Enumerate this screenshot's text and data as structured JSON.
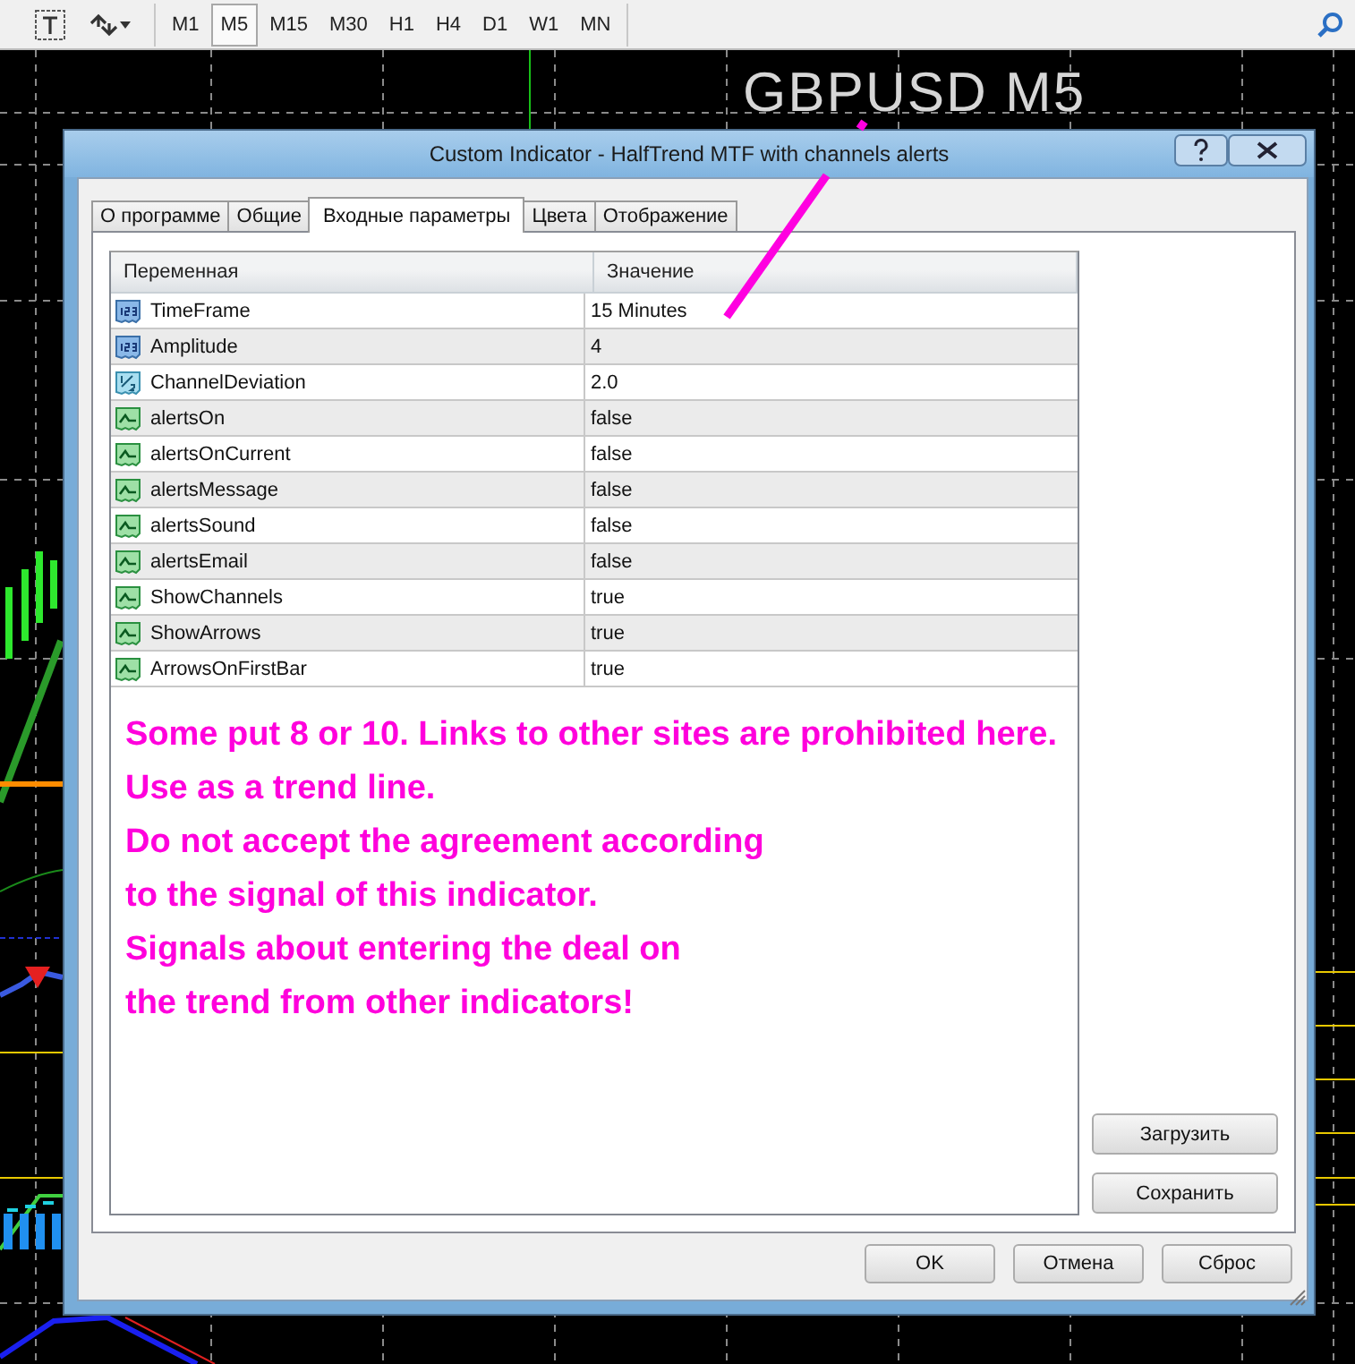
{
  "toolbar": {
    "timeframes": [
      {
        "label": "M1",
        "selected": false
      },
      {
        "label": "M5",
        "selected": true
      },
      {
        "label": "M15",
        "selected": false
      },
      {
        "label": "M30",
        "selected": false
      },
      {
        "label": "H1",
        "selected": false
      },
      {
        "label": "H4",
        "selected": false
      },
      {
        "label": "D1",
        "selected": false
      },
      {
        "label": "W1",
        "selected": false
      },
      {
        "label": "MN",
        "selected": false
      }
    ]
  },
  "chart": {
    "symbol": "GBPUSD M5"
  },
  "dialog": {
    "title": "Custom Indicator - HalfTrend MTF with channels alerts",
    "tabs": [
      {
        "label": "О программе",
        "selected": false
      },
      {
        "label": "Общие",
        "selected": false
      },
      {
        "label": "Входные параметры",
        "selected": true
      },
      {
        "label": "Цвета",
        "selected": false
      },
      {
        "label": "Отображение",
        "selected": false
      }
    ],
    "table": {
      "columns": [
        "Переменная",
        "Значение"
      ],
      "rows": [
        {
          "kind": "int",
          "name": "TimeFrame",
          "value": "15 Minutes"
        },
        {
          "kind": "int",
          "name": "Amplitude",
          "value": "4"
        },
        {
          "kind": "double",
          "name": "ChannelDeviation",
          "value": "2.0"
        },
        {
          "kind": "bool",
          "name": "alertsOn",
          "value": "false"
        },
        {
          "kind": "bool",
          "name": "alertsOnCurrent",
          "value": "false"
        },
        {
          "kind": "bool",
          "name": "alertsMessage",
          "value": "false"
        },
        {
          "kind": "bool",
          "name": "alertsSound",
          "value": "false"
        },
        {
          "kind": "bool",
          "name": "alertsEmail",
          "value": "false"
        },
        {
          "kind": "bool",
          "name": "ShowChannels",
          "value": "true"
        },
        {
          "kind": "bool",
          "name": "ShowArrows",
          "value": "true"
        },
        {
          "kind": "bool",
          "name": "ArrowsOnFirstBar",
          "value": "true"
        }
      ]
    },
    "side_buttons": [
      "Загрузить",
      "Сохранить"
    ],
    "buttons": [
      "OK",
      "Отмена",
      "Сброс"
    ]
  },
  "annotation": {
    "lines": [
      "Some put 8 or 10. Links to other sites are prohibited here.",
      "Use as a trend line.",
      "Do not accept the agreement according",
      "to the signal of this indicator.",
      "Signals about entering the deal on",
      "the trend from other indicators!"
    ]
  }
}
